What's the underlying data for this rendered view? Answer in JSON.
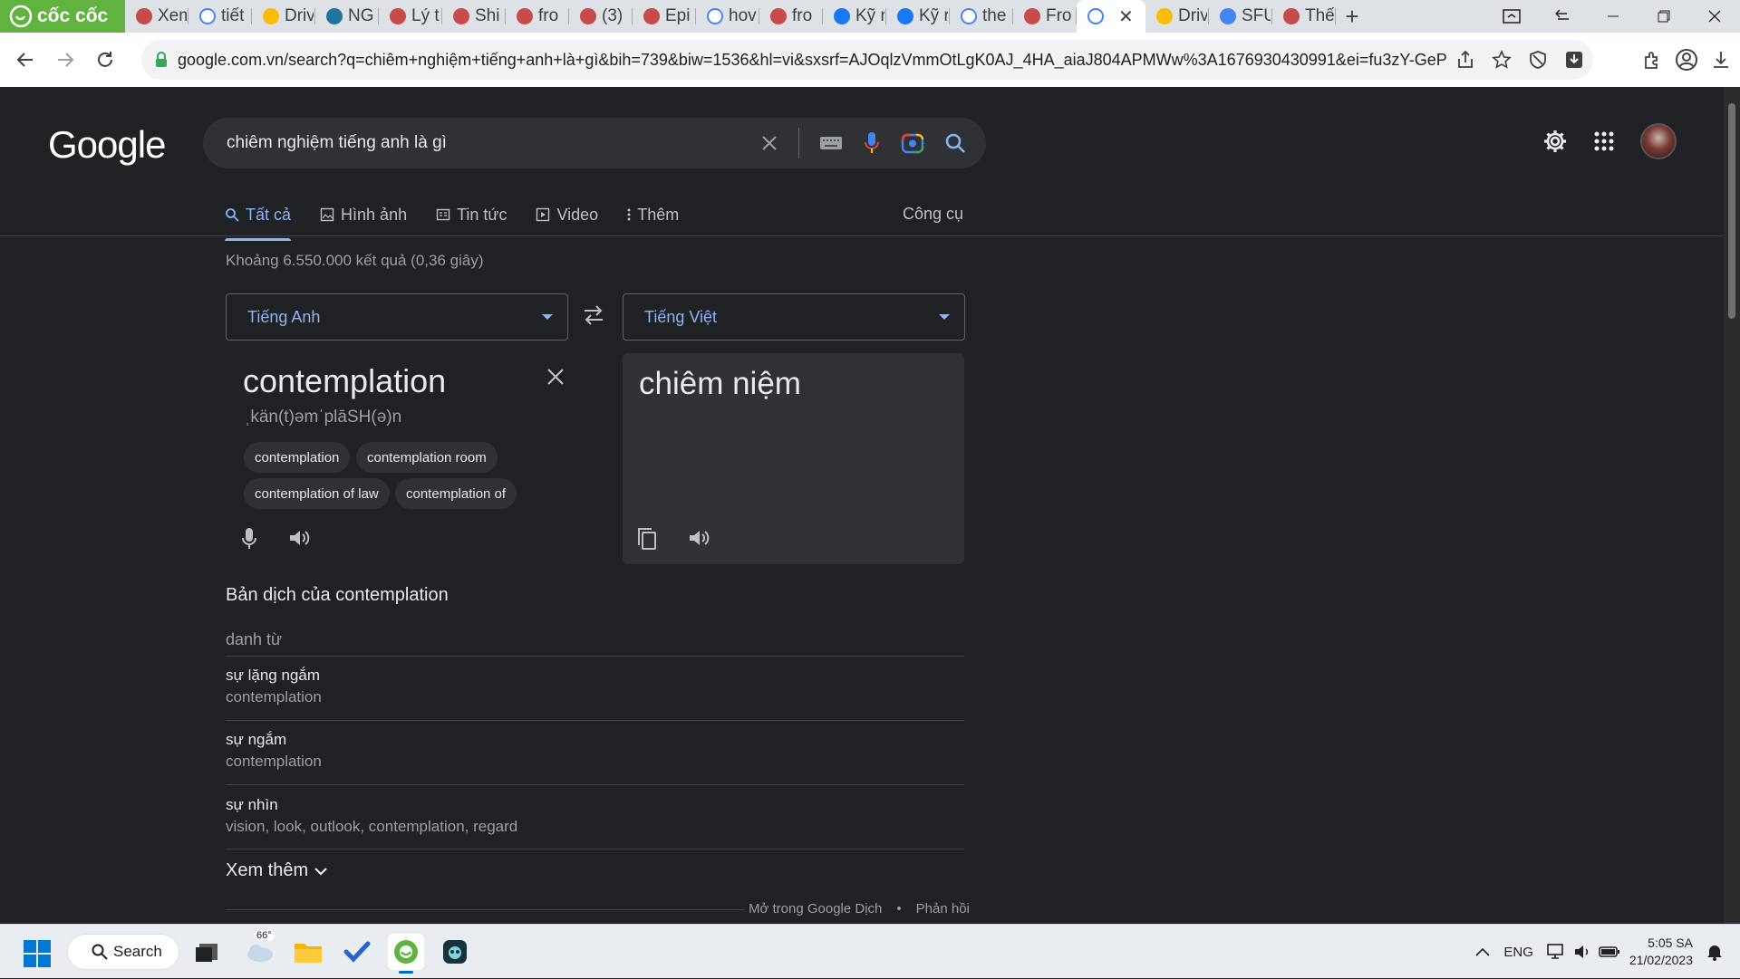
{
  "browser": {
    "brand_name": "cốc cốc",
    "tabs": [
      {
        "title": "Xem",
        "icon": "tab-favicon"
      },
      {
        "title": "tiết",
        "icon": "google-icon"
      },
      {
        "title": "Driv",
        "icon": "drive-icon"
      },
      {
        "title": "NG",
        "icon": "wordpress-icon"
      },
      {
        "title": "Lý t",
        "icon": "tab-favicon"
      },
      {
        "title": "Shi",
        "icon": "tab-favicon"
      },
      {
        "title": "fro",
        "icon": "tab-favicon"
      },
      {
        "title": "(3)",
        "icon": "tab-favicon"
      },
      {
        "title": "Epi",
        "icon": "tab-favicon"
      },
      {
        "title": "hov",
        "icon": "google-icon"
      },
      {
        "title": "fro",
        "icon": "tab-favicon"
      },
      {
        "title": "Kỹ r",
        "icon": "facebook-icon"
      },
      {
        "title": "Kỹ r",
        "icon": "facebook-icon"
      },
      {
        "title": "the",
        "icon": "google-icon"
      },
      {
        "title": "Fro",
        "icon": "tab-favicon"
      }
    ],
    "active_tab": {
      "title": "",
      "icon": "google-icon"
    },
    "tabs_after": [
      {
        "title": "Driv",
        "icon": "drive-icon"
      },
      {
        "title": "SFU",
        "icon": "docs-icon"
      },
      {
        "title": "Thế",
        "icon": "tab-favicon"
      }
    ],
    "url": "google.com.vn/search?q=chiêm+nghiệm+tiếng+anh+là+gì&bih=739&biw=1536&hl=vi&sxsrf=AJOqlzVmmOtLgK0AJ_4HA_aiaJ804APMWw%3A1676930430991&ei=fu3zY-GeP..."
  },
  "google": {
    "logo": "Google",
    "query": "chiêm nghiệm tiếng anh là gì",
    "nav": [
      {
        "label": "Tất cả",
        "icon": "search-icon"
      },
      {
        "label": "Hình ảnh",
        "icon": "image-icon"
      },
      {
        "label": "Tin tức",
        "icon": "news-icon"
      },
      {
        "label": "Video",
        "icon": "video-icon"
      },
      {
        "label": "Thêm",
        "icon": "more-dots-icon"
      }
    ],
    "tools": "Công cụ",
    "result_stats": "Khoảng 6.550.000 kết quả (0,36 giây)"
  },
  "translate": {
    "source_lang": "Tiếng Anh",
    "target_lang": "Tiếng Việt",
    "source_word": "contemplation",
    "phonetic": "ˌkän(t)əmˈplāSH(ə)n",
    "suggestions": [
      "contemplation",
      "contemplation room",
      "contemplation of law",
      "contemplation of"
    ],
    "target_word": "chiêm niệm"
  },
  "dictionary": {
    "title": "Bản dịch của contemplation",
    "part_of_speech": "danh từ",
    "entries": [
      {
        "word": "sự lặng ngắm",
        "synonyms": "contemplation"
      },
      {
        "word": "sự ngắm",
        "synonyms": "contemplation"
      },
      {
        "word": "sự nhìn",
        "synonyms": "vision, look, outlook, contemplation, regard"
      }
    ],
    "more": "Xem thêm",
    "open_in_translate": "Mở trong Google Dịch",
    "separator": "•",
    "feedback": "Phản hồi"
  },
  "taskbar": {
    "search_label": "Search",
    "weather_temp": "66°",
    "language": "ENG",
    "time": "5:05 SA",
    "date": "21/02/2023"
  }
}
